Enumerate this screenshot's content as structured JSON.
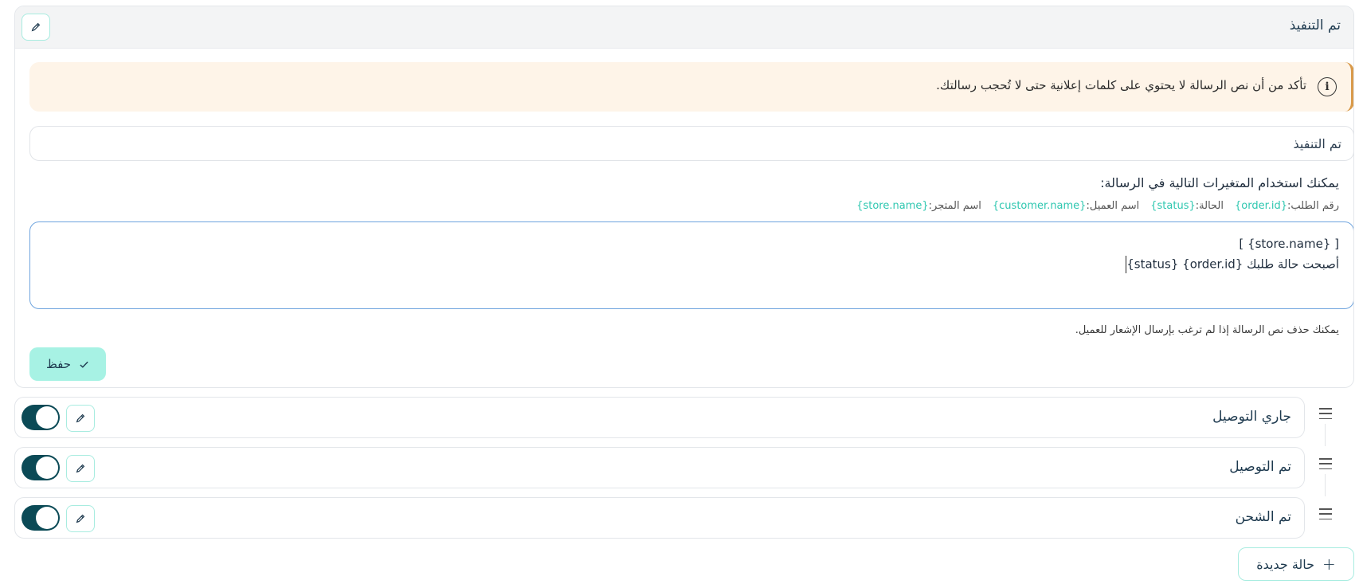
{
  "editor": {
    "title": "تم التنفيذ",
    "alert_text": "تأكد من أن نص الرسالة لا يحتوي على كلمات إعلانية حتى لا تُحجب رسالتك.",
    "title_input_value": "تم التنفيذ",
    "variables_title": "يمكنك استخدام المتغيرات التالية في الرسالة:",
    "variables": [
      {
        "label": "رقم الطلب:",
        "code": "{order.id}"
      },
      {
        "label": "الحالة:",
        "code": "{status}"
      },
      {
        "label": "اسم العميل:",
        "code": "{customer.name}"
      },
      {
        "label": "اسم المتجر:",
        "code": "{store.name}"
      }
    ],
    "message_line1": "[ {store.name} ]",
    "message_line2": "أصبحت حالة طلبك {order.id} {status}",
    "hint": "يمكنك حذف نص الرسالة إذا لم ترغب بإرسال الإشعار للعميل.",
    "save_label": "حفظ"
  },
  "statuses": [
    {
      "label": "جاري التوصيل",
      "enabled": true
    },
    {
      "label": "تم التوصيل",
      "enabled": true
    },
    {
      "label": "تم الشحن",
      "enabled": true
    }
  ],
  "new_status_label": "حالة جديدة",
  "colors": {
    "accent": "#a7f2e4",
    "accent_border": "#a8ece0",
    "toggle_on": "#0b4a56",
    "variable_text": "#2ec7b0",
    "alert_bg": "#fef4e8",
    "alert_border": "#d99a4a"
  }
}
